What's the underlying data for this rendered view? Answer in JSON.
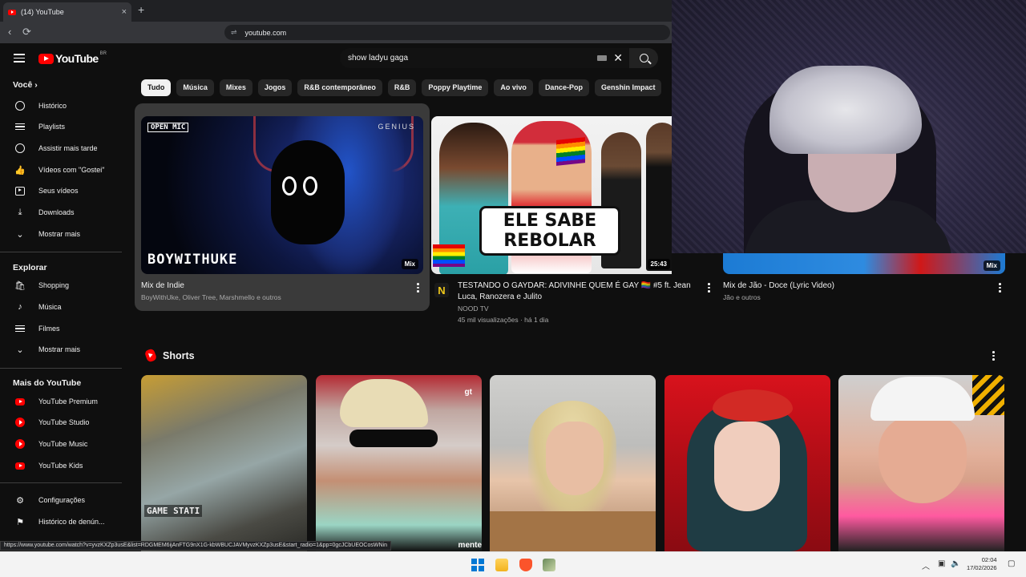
{
  "browser": {
    "tab_title": "(14) YouTube",
    "tab_close": "×",
    "new_tab": "+",
    "url": "youtube.com",
    "back": "‹",
    "reload": "⟳",
    "tune": "⇌"
  },
  "header": {
    "logo_text": "YouTube",
    "region": "BR",
    "search_value": "show ladyu gaga",
    "clear": "✕"
  },
  "sidebar": {
    "voce_title": "Você",
    "voce_chevron": "›",
    "voce_items": [
      {
        "label": "Histórico",
        "icon": "history-icon"
      },
      {
        "label": "Playlists",
        "icon": "playlists-icon"
      },
      {
        "label": "Assistir mais tarde",
        "icon": "watch-later-icon"
      },
      {
        "label": "Vídeos com \"Gostei\"",
        "icon": "like-icon"
      },
      {
        "label": "Seus vídeos",
        "icon": "your-videos-icon"
      },
      {
        "label": "Downloads",
        "icon": "download-icon"
      },
      {
        "label": "Mostrar mais",
        "icon": "chevron-down-icon"
      }
    ],
    "explorar_title": "Explorar",
    "explorar_items": [
      {
        "label": "Shopping",
        "icon": "shopping-icon"
      },
      {
        "label": "Música",
        "icon": "music-icon"
      },
      {
        "label": "Filmes",
        "icon": "movies-icon"
      },
      {
        "label": "Mostrar mais",
        "icon": "chevron-down-icon"
      }
    ],
    "mais_title": "Mais do YouTube",
    "mais_items": [
      {
        "label": "YouTube Premium",
        "icon": "youtube-premium-icon"
      },
      {
        "label": "YouTube Studio",
        "icon": "youtube-studio-icon"
      },
      {
        "label": "YouTube Music",
        "icon": "youtube-music-icon"
      },
      {
        "label": "YouTube Kids",
        "icon": "youtube-kids-icon"
      }
    ],
    "bottom_items": [
      {
        "label": "Configurações",
        "icon": "settings-icon"
      },
      {
        "label": "Histórico de denún...",
        "icon": "flag-icon"
      }
    ]
  },
  "chips": [
    "Tudo",
    "Música",
    "Mixes",
    "Jogos",
    "R&B contemporâneo",
    "R&B",
    "Poppy Playtime",
    "Ao vivo",
    "Dance-Pop",
    "Genshin Impact"
  ],
  "videos": [
    {
      "title": "Mix de Indie",
      "subtitle": "BoyWithUke, Oliver Tree, Marshmello e outros",
      "badge": "Mix",
      "thumb_text_top_left": "OPEN MIC",
      "thumb_text_top_right": "GENIUS",
      "thumb_text_bottom": "BOYWITHUKE"
    },
    {
      "title": "TESTANDO O GAYDAR: ADIVINHE QUEM É GAY 🏳️‍🌈 #5 ft. Jean Luca, Ranozera e Julito",
      "channel": "NOOD TV",
      "stats": "45 mil visualizações · há 1 dia",
      "duration": "25:43",
      "thumb_caption_1": "ELE SABE",
      "thumb_caption_2": "REBOLAR",
      "channel_initial": "N"
    },
    {
      "title": "Mix de Jão - Doce (Lyric Video)",
      "subtitle": "Jão e outros",
      "badge": "Mix"
    }
  ],
  "shorts": {
    "title": "Shorts",
    "items": [
      {
        "overlay": "GAME STATI"
      },
      {
        "overlay": "gt",
        "subtitle": "mente"
      },
      {
        "overlay": ""
      },
      {
        "overlay": ""
      },
      {
        "overlay": ""
      }
    ]
  },
  "status_url": "https://www.youtube.com/watch?v=yvzKXZp3usE&list=RDGMEM6ijAnFTG9nX1G-kbWBUCJAVMyvzKXZp3usE&start_radio=1&pp=0gcJCbUEOCosWNin",
  "taskbar": {
    "time": "02:04",
    "date": "17/02/2026",
    "tray_chevron": "︿"
  }
}
